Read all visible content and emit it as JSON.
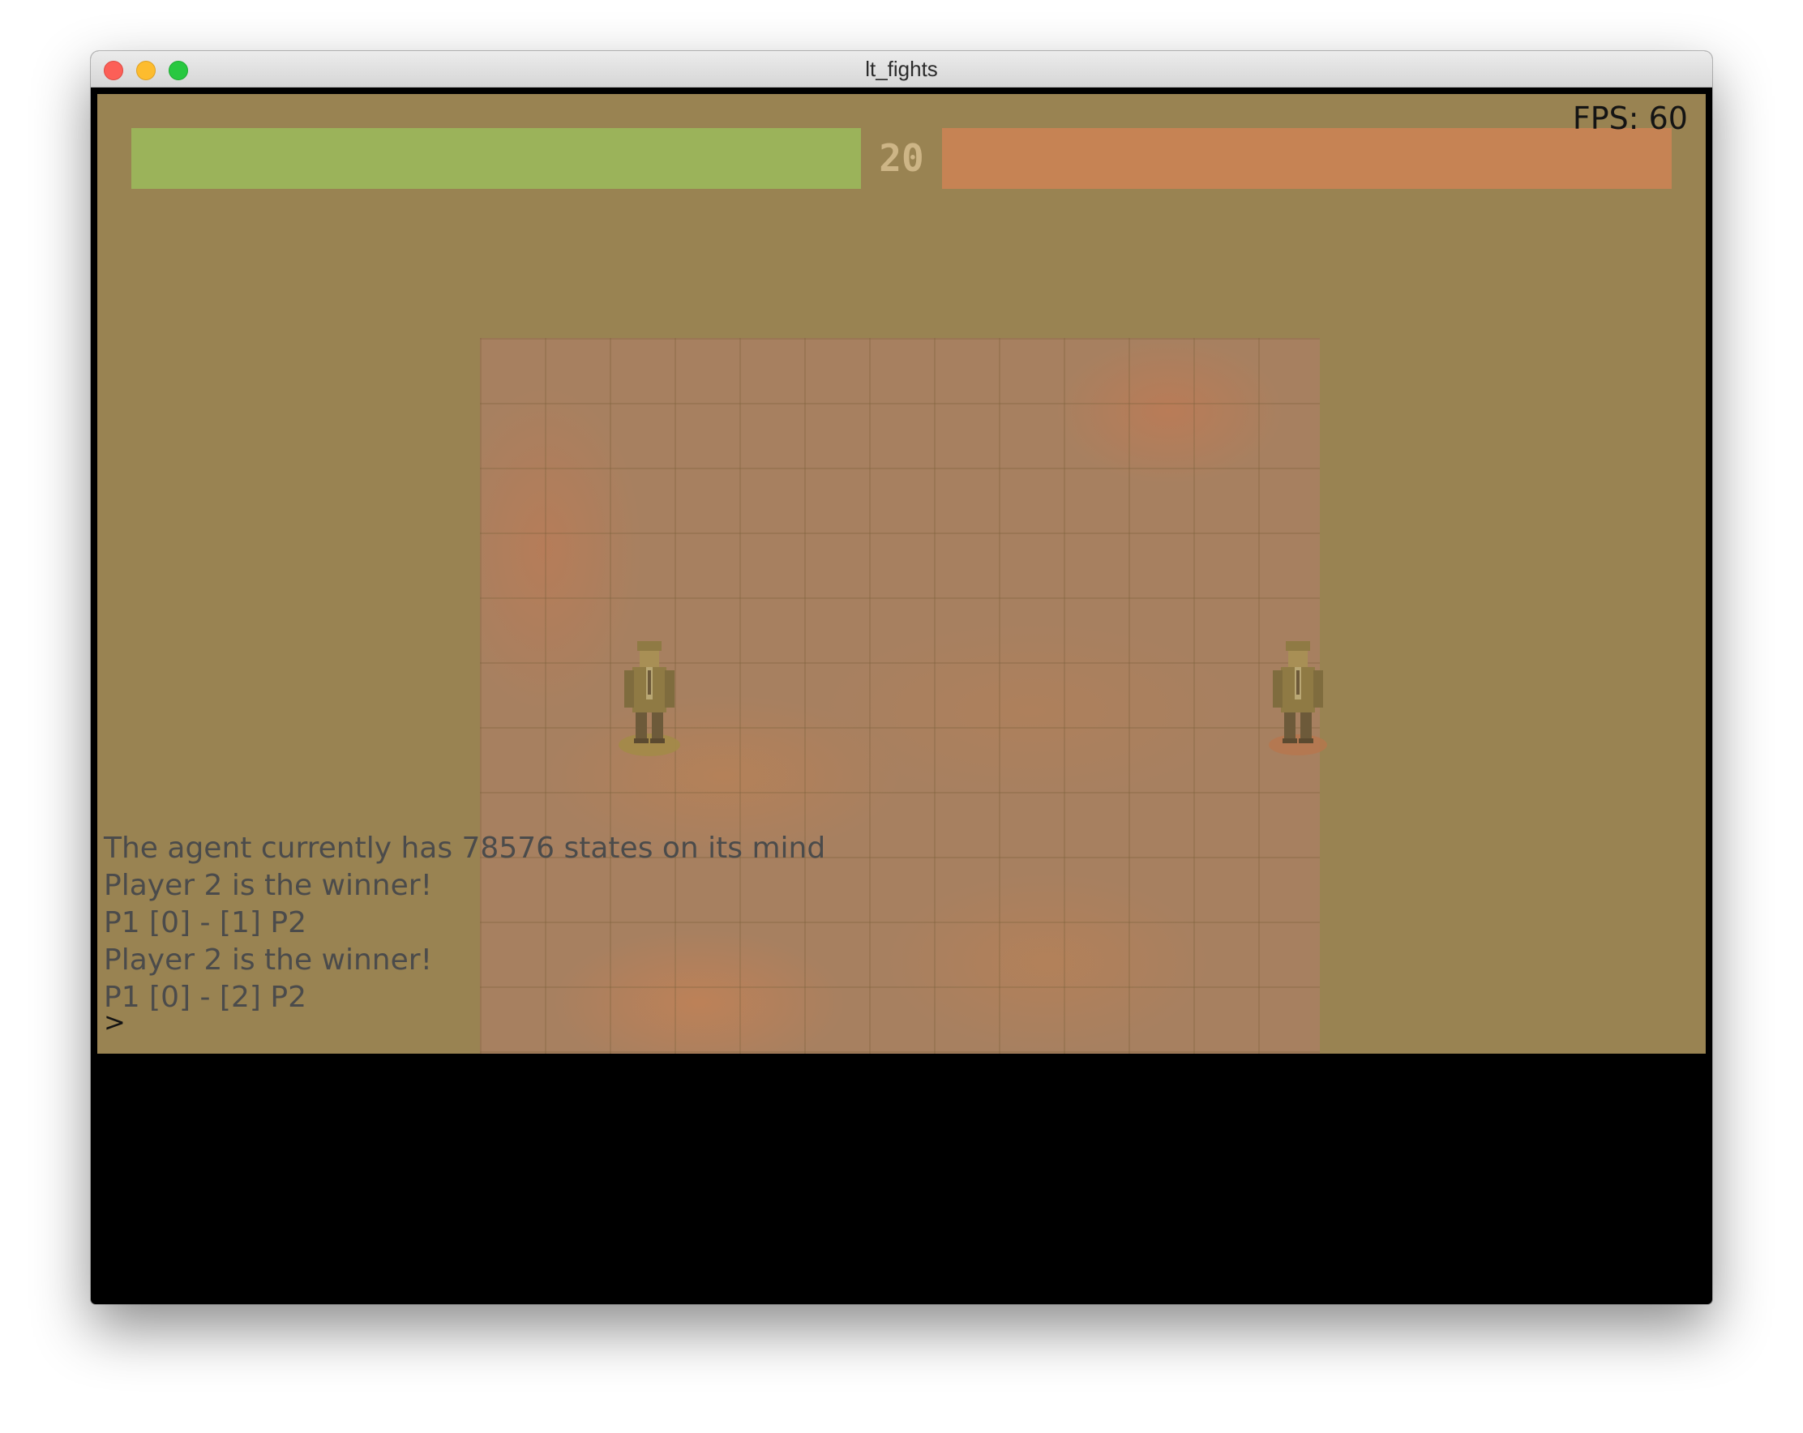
{
  "window": {
    "title": "lt_fights"
  },
  "hud": {
    "fps": "FPS: 60",
    "timer": "20",
    "p1_health": 1.0,
    "p2_health": 1.0,
    "p1_color": "#9bb35a",
    "p2_color": "#c68354"
  },
  "arena": {
    "floor_color": "#a78060",
    "background_color": "#998352"
  },
  "fighters": [
    {
      "icon": "fighter-sprite",
      "color": "#8f7a44"
    },
    {
      "icon": "fighter-sprite",
      "color": "#8f7a44"
    }
  ],
  "log": {
    "lines": [
      "The agent currently has 78576 states on its mind",
      "Player 2 is the winner!",
      "P1 [0] - [1] P2",
      "Player 2 is the winner!",
      "P1 [0] - [2] P2"
    ],
    "prompt": ">"
  }
}
